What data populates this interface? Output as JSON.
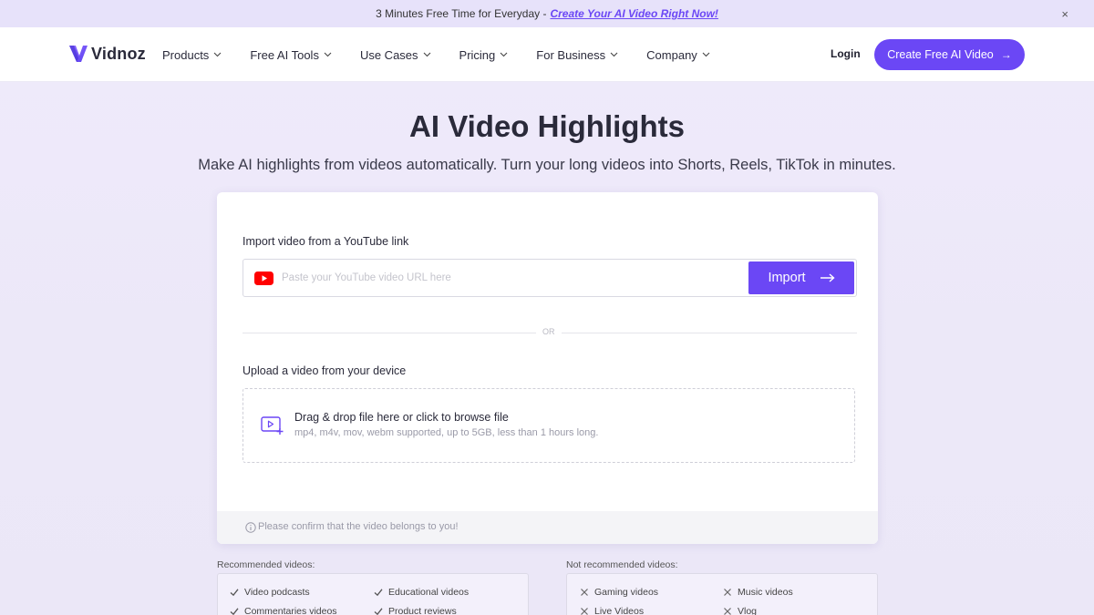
{
  "promo": {
    "text": "3 Minutes Free Time for Everyday - ",
    "link": "Create Your AI Video Right Now!",
    "close": "×"
  },
  "header": {
    "logo_text": "Vidnoz",
    "nav": [
      "Products",
      "Free AI Tools",
      "Use Cases",
      "Pricing",
      "For Business",
      "Company"
    ],
    "login": "Login",
    "cta": "Create Free AI Video",
    "cta_arrow": "→"
  },
  "hero": {
    "title": "AI Video Highlights",
    "subtitle": "Make AI highlights from videos automatically. Turn your long videos into Shorts, Reels, TikTok in minutes."
  },
  "card": {
    "youtube_label": "Import video from a YouTube link",
    "youtube_placeholder": "Paste your YouTube video URL here",
    "import_label": "Import",
    "or": "OR",
    "upload_label": "Upload a video from your device",
    "drop_title": "Drag & drop file here or click to browse file",
    "drop_sub": "mp4, m4v, mov, webm supported, up to 5GB, less than 1 hours long.",
    "confirm": "Please confirm that the video belongs to you!"
  },
  "recommended": {
    "label": "Recommended videos:",
    "items": [
      "Video podcasts",
      "Educational videos",
      "Commentaries videos",
      "Product reviews"
    ]
  },
  "not_recommended": {
    "label": "Not recommended videos:",
    "items": [
      "Gaming videos",
      "Music videos",
      "Live Videos",
      "Vlog"
    ]
  },
  "colors": {
    "accent": "#6b47f5",
    "youtube_red": "#ff0000"
  }
}
